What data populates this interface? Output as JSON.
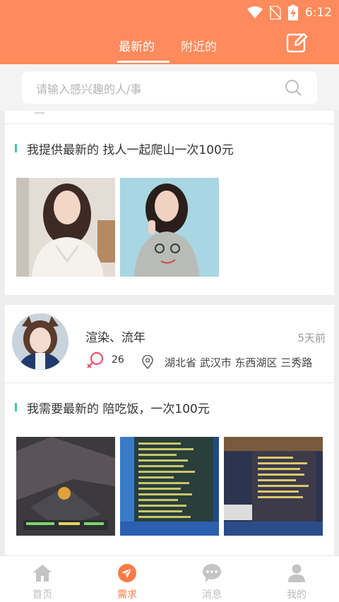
{
  "status_bar": {
    "time": "6:12"
  },
  "tabs": [
    {
      "label": "最新的",
      "active": true
    },
    {
      "label": "附近的",
      "active": false
    }
  ],
  "search": {
    "placeholder": "请输入感兴趣的人/事"
  },
  "posts": [
    {
      "requirement": "我提供最新的 找人一起爬山一次100元",
      "photos": [
        "girl-white-sweater-photo",
        "girl-gray-sweater-photo"
      ]
    },
    {
      "user": {
        "name": "渲染、流年",
        "age": "26",
        "time_ago": "5天前"
      },
      "location": "湖北省 武汉市 东西湖区 三秀路",
      "requirement": "我需要最新的 陪吃饭，一次100元",
      "photos": [
        "game-screenshot-1",
        "game-screenshot-2",
        "game-screenshot-3"
      ]
    }
  ],
  "tabbar": [
    {
      "label": "首页",
      "icon": "home-icon",
      "active": false
    },
    {
      "label": "需求",
      "icon": "send-icon",
      "active": true
    },
    {
      "label": "消息",
      "icon": "chat-icon",
      "active": false
    },
    {
      "label": "我的",
      "icon": "user-icon",
      "active": false
    }
  ],
  "colors": {
    "primary": "#ff8a5c",
    "accent_bar": "#3ec7b0",
    "active_tab": "#ff7a45"
  }
}
